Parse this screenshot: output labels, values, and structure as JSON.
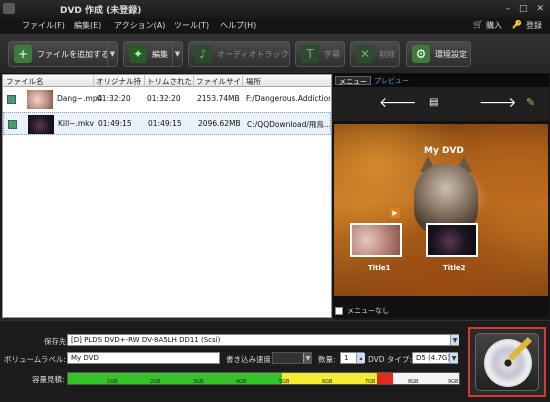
{
  "window": {
    "title": "DVD 作成 (未登録)",
    "controls": [
      "–",
      "□",
      "✕"
    ]
  },
  "menubar": {
    "items": [
      "ファイル(F)",
      "編集(E)",
      "アクション(A)",
      "ツール(T)",
      "ヘルプ(H)"
    ],
    "right": [
      "購入",
      "登録"
    ]
  },
  "toolbar": {
    "add_file": "ファイルを追加する",
    "edit": "編集",
    "audio_track": "オーディオトラック",
    "subtitle": "字幕",
    "delete": "削除",
    "settings": "環境設定"
  },
  "filelist": {
    "columns": [
      "ファイル名",
      "オリジナル持",
      "トリムされた",
      "ファイルサイ",
      "場所"
    ],
    "rows": [
      {
        "name": "Dang~.mp4",
        "original": "01:32:20",
        "trimmed": "01:32:20",
        "size": "2153.74MB",
        "location": "F:/Dangerous.Addiction..."
      },
      {
        "name": "Kill~.mkv",
        "original": "01:49:15",
        "trimmed": "01:49:15",
        "size": "2096.62MB",
        "location": "C:/QQDownload/飛鳥..."
      }
    ]
  },
  "preview": {
    "tab_menu": "メニュー",
    "tab_preview": "プレビュー",
    "menu_title": "My DVD",
    "title1": "Title1",
    "title2": "Title2",
    "no_menu": "メニューなし"
  },
  "bottom": {
    "save_label": "保存先:",
    "save_value": "[D] PLDS DVD+-RW DV-8A5LH DD11 (Scsi)",
    "volume_label": "ボリュームラベル:",
    "volume_value": "My DVD",
    "speed_label": "書き込み速度:",
    "copies_label": "数量:",
    "copies_value": "1",
    "dvd_type_label": "DVD タイプ:",
    "dvd_type_value": "D5 (4.7G)",
    "capacity_label": "容量見積:",
    "capacity_ticks": [
      "1GB",
      "2GB",
      "3GB",
      "4GB",
      "5GB",
      "6GB",
      "7GB",
      "8GB",
      "9GB"
    ]
  }
}
